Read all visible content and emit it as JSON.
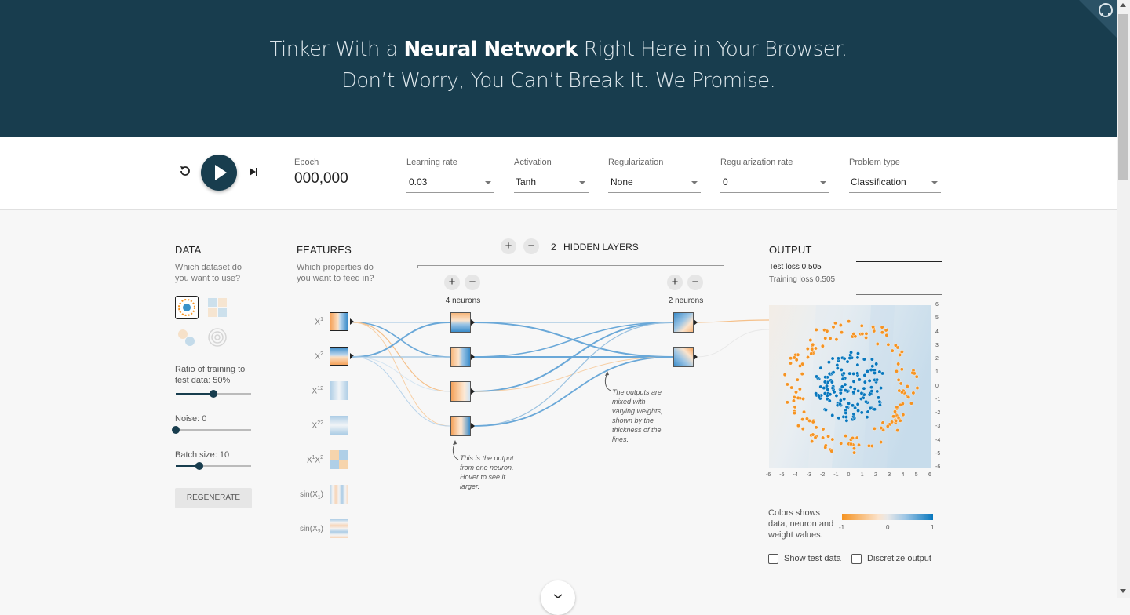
{
  "header": {
    "line1_pre": "Tinker With a ",
    "line1_bold": "Neural Network",
    "line1_post": " Right Here in Your Browser.",
    "line2": "Don’t Worry, You Can’t Break It. We Promise."
  },
  "controls": {
    "epoch_label": "Epoch",
    "epoch_value": "000,000",
    "learning_rate": {
      "label": "Learning rate",
      "value": "0.03"
    },
    "activation": {
      "label": "Activation",
      "value": "Tanh"
    },
    "regularization": {
      "label": "Regularization",
      "value": "None"
    },
    "regularization_rate": {
      "label": "Regularization rate",
      "value": "0"
    },
    "problem_type": {
      "label": "Problem type",
      "value": "Classification"
    }
  },
  "data_panel": {
    "title": "DATA",
    "question": [
      "Which dataset do",
      "you want to use?"
    ],
    "ratio_label": [
      "Ratio of training to",
      "test data:  50%"
    ],
    "ratio_value": 0.5,
    "noise_label": "Noise:  0",
    "noise_value": 0,
    "batch_label": "Batch size:  10",
    "batch_value": 0.3,
    "regenerate": "REGENERATE"
  },
  "features_panel": {
    "title": "FEATURES",
    "question": [
      "Which properties do",
      "you want to feed in?"
    ],
    "features": [
      {
        "label": "X",
        "sup": "1"
      },
      {
        "label": "X",
        "sup": "2"
      },
      {
        "label": "X",
        "sup": "12"
      },
      {
        "label": "X",
        "sup": "22"
      },
      {
        "label": "X",
        "sup": "1",
        "label2": "X",
        "sup2": "2"
      },
      {
        "label": "sin(X",
        "sub": "1",
        "post": ")"
      },
      {
        "label": "sin(X",
        "sub": "2",
        "post": ")"
      }
    ]
  },
  "network": {
    "hidden_layers_count": "2",
    "hidden_layers_label": "HIDDEN LAYERS",
    "layer1_neurons": "4 neurons",
    "layer2_neurons": "2 neurons",
    "plus": "+",
    "minus": "−",
    "note_neuron": [
      "This is the output",
      "from one neuron.",
      "Hover to see it",
      "larger."
    ],
    "note_weights": [
      "The outputs are",
      "mixed with",
      "varying weights,",
      "shown by the",
      "thickness of the",
      "lines."
    ]
  },
  "output_panel": {
    "title": "OUTPUT",
    "test_loss": "Test loss 0.505",
    "training_loss": "Training loss 0.505",
    "x_ticks": [
      "-6",
      "-5",
      "-4",
      "-3",
      "-2",
      "-1",
      "0",
      "1",
      "2",
      "3",
      "4",
      "5",
      "6"
    ],
    "y_ticks": [
      "6",
      "5",
      "4",
      "3",
      "2",
      "1",
      "0",
      "-1",
      "-2",
      "-3",
      "-4",
      "-5",
      "-6"
    ],
    "colors_note": [
      "Colors shows",
      "data, neuron and",
      "weight values."
    ],
    "legend_ticks": [
      "-1",
      "0",
      "1"
    ],
    "show_test_data": "Show test data",
    "discretize_output": "Discretize output"
  },
  "colors": {
    "header_bg": "#183d4e",
    "orange": "#f59322",
    "blue": "#0877bd"
  }
}
